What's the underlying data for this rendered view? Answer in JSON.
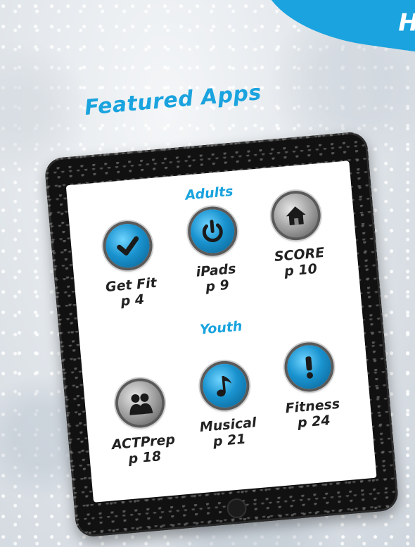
{
  "banner": {
    "text": "Hi"
  },
  "title": "Featured Apps",
  "sections": {
    "adults": {
      "heading": "Adults",
      "apps": [
        {
          "name": "Get Fit",
          "page": "p 4",
          "icon": "checkmark-icon"
        },
        {
          "name": "iPads",
          "page": "p 9",
          "icon": "power-icon"
        },
        {
          "name": "SCORE",
          "page": "p 10",
          "icon": "home-icon"
        }
      ]
    },
    "youth": {
      "heading": "Youth",
      "apps": [
        {
          "name": "ACTPrep",
          "page": "p 18",
          "icon": "people-icon"
        },
        {
          "name": "Musical",
          "page": "p 21",
          "icon": "music-note-icon"
        },
        {
          "name": "Fitness",
          "page": "p 24",
          "icon": "exclamation-icon"
        }
      ]
    }
  },
  "colors": {
    "accent": "#1aa3de",
    "tablet": "#111111"
  }
}
